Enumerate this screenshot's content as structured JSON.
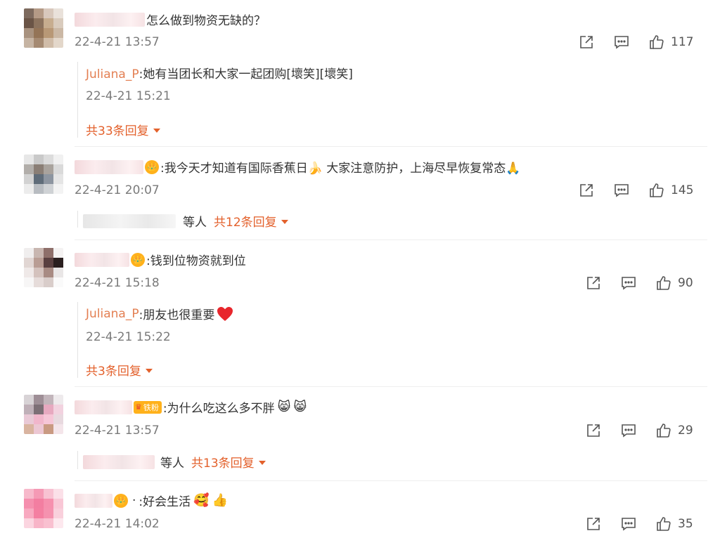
{
  "comments": [
    {
      "text": "怎么做到物资无缺的？",
      "time": "22-4-21 13:57",
      "likes": "117",
      "reply": {
        "user": "Juliana_P",
        "text": ":她有当团长和大家一起团购[壞笑][壞笑]",
        "time": "22-4-21 15:21"
      },
      "more": "共33条回复"
    },
    {
      "badge": "👑",
      "text": ":我今天才知道有国际香蕉日🍌  大家注意防护，上海尽早恢复常态🙏",
      "time": "22-4-21 20:07",
      "likes": "145",
      "summary_suffix": "等人",
      "more": "共12条回复"
    },
    {
      "badge": "👑",
      "text": ":钱到位物资就到位",
      "time": "22-4-21 15:18",
      "likes": "90",
      "reply": {
        "user": "Juliana_P",
        "text": ":朋友也很重要",
        "time": "22-4-21 15:22"
      },
      "more": "共3条回复"
    },
    {
      "fan_badge": "铁粉",
      "text": ":为什么吃这么多不胖",
      "time": "22-4-21 13:57",
      "likes": "29",
      "summary_suffix": "等人",
      "more": "共13条回复"
    },
    {
      "badge": "👑",
      "text": ":好会生活",
      "time": "22-4-21 14:02",
      "likes": "35"
    }
  ],
  "icons": {
    "share": "share-icon",
    "comment": "comment-icon",
    "like": "like-icon",
    "expand": "chevron-down-icon"
  },
  "colors": {
    "accent": "#e3612c",
    "reply_user": "#e37f52",
    "time": "#7a7a7a",
    "badge": "#ffb11b"
  }
}
